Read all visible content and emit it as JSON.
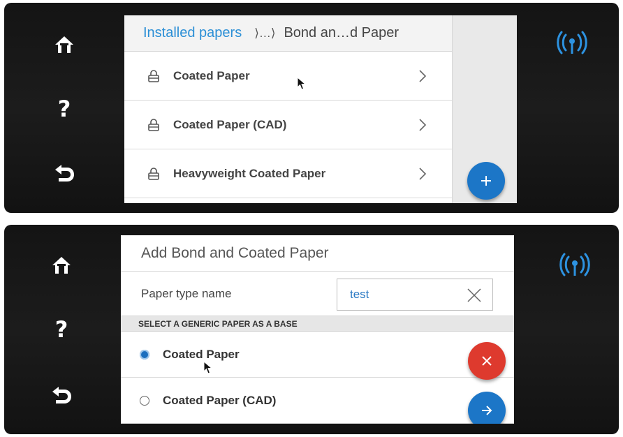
{
  "panel1": {
    "breadcrumb": {
      "link": "Installed papers",
      "separator": "⟩…⟩",
      "current": "Bond an…d Paper"
    },
    "items": [
      {
        "label": "Coated Paper",
        "icon": "lock-icon",
        "action": "chevron-right-icon"
      },
      {
        "label": "Coated Paper (CAD)",
        "icon": "lock-icon",
        "action": "chevron-right-icon"
      },
      {
        "label": "Heavyweight Coated Paper",
        "icon": "lock-icon",
        "action": "chevron-right-icon"
      }
    ],
    "fab": {
      "icon": "plus-icon",
      "color": "#1c76c7"
    }
  },
  "panel2": {
    "title": "Add Bond and Coated Paper",
    "name_field": {
      "label": "Paper type name",
      "value": "test"
    },
    "section_header": "SELECT A GENERIC PAPER AS A BASE",
    "options": [
      {
        "label": "Coated Paper",
        "selected": true
      },
      {
        "label": "Coated Paper (CAD)",
        "selected": false
      }
    ],
    "cancel_fab": {
      "icon": "close-icon",
      "color": "#de3a2e"
    },
    "next_fab": {
      "icon": "arrow-right-icon",
      "color": "#1c76c7"
    }
  },
  "sidebar": {
    "icons": [
      "home-icon",
      "help-icon",
      "back-icon"
    ],
    "help_glyph": "?"
  },
  "status": {
    "icon": "wireless-icon",
    "color": "#2d92e0"
  },
  "colors": {
    "accent": "#2b8fd6",
    "bezel": "#161616"
  }
}
